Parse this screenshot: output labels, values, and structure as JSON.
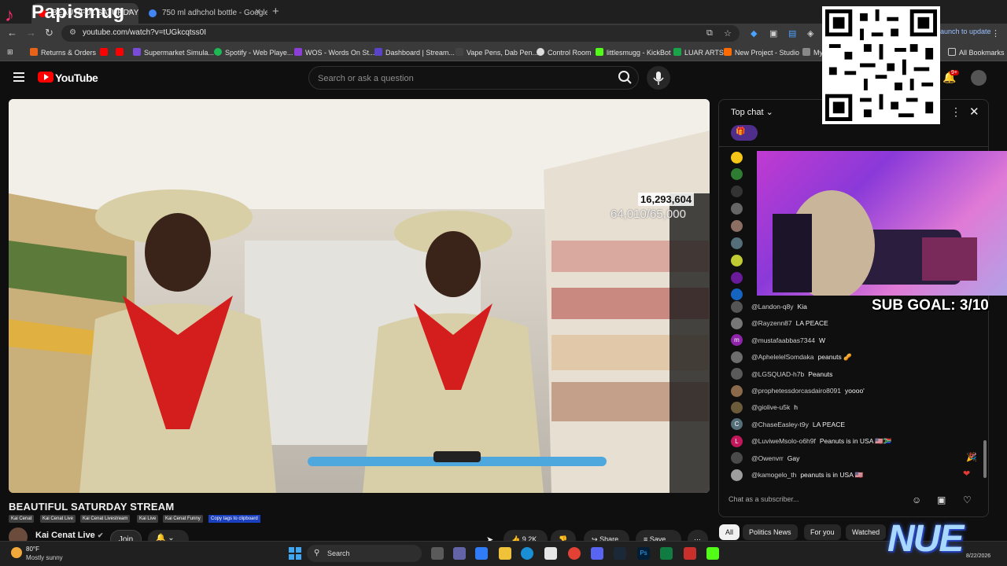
{
  "browser": {
    "branding": "Papismug",
    "tabs": [
      {
        "label": "BEAUTIFUL SATURDAY",
        "active": true
      },
      {
        "label": "750 ml adhchol bottle - Google",
        "active": false
      }
    ],
    "new_tab": "+",
    "url": "youtube.com/watch?v=tUGkcqtss0I",
    "launch_update": "Launch to update",
    "bookmarks": [
      {
        "label": "Returns & Orders",
        "color": "#e8631a"
      },
      {
        "label": "Supermarket Simula...",
        "color": "#7a4bd8"
      },
      {
        "label": "Spotify - Web Playe...",
        "color": "#1db954"
      },
      {
        "label": "WOS - Words On St...",
        "color": "#8b3fd6"
      },
      {
        "label": "Dashboard | Stream...",
        "color": "#5b43c8"
      },
      {
        "label": "Vape Pens, Dab Pen...",
        "color": "#444444"
      },
      {
        "label": "Control Room",
        "color": "#dddddd"
      },
      {
        "label": "littlesmugg - KickBot",
        "color": "#53fc18"
      },
      {
        "label": "LUAR ARTS",
        "color": "#1aa34a"
      },
      {
        "label": "New Project - Studio",
        "color": "#ff6b00"
      },
      {
        "label": "My",
        "color": "#888888"
      }
    ],
    "all_bookmarks": "All Bookmarks"
  },
  "youtube": {
    "wordmark": "YouTube",
    "search_placeholder": "Search or ask a question",
    "notifications": "9+"
  },
  "video": {
    "overlay_count": "16,293,604",
    "overlay_goal": "64,010/65,000",
    "title": "BEAUTIFUL SATURDAY STREAM",
    "tags": [
      "Kai Cenat",
      "Kai Cenat Live",
      "Kai Cenat Livestream",
      "Kai Live",
      "Kai Cenat Funny"
    ],
    "copy_tags": "Copy tags to clipboard",
    "channel": "Kai Cenat Live",
    "join": "Join",
    "likes": "9.2K",
    "share": "Share",
    "save": "Save"
  },
  "chat": {
    "header": "Top chat",
    "input_placeholder": "Chat as a subscriber...",
    "messages": [
      {
        "author": "@Landon-q8y",
        "text": "Kia",
        "color": "#555555"
      },
      {
        "author": "@Rayzenn87",
        "text": "LA PEACE",
        "color": "#777777"
      },
      {
        "author": "@mustafaabbas7344",
        "text": "W",
        "color": "#8e24aa",
        "initial": "m"
      },
      {
        "author": "@AphelelelSomdaka",
        "text": "peanuts 🥜",
        "color": "#6d6d6d"
      },
      {
        "author": "@LGSQUAD-h7b",
        "text": "Peanuts",
        "color": "#5a5a5a"
      },
      {
        "author": "@prophetessdorcasdairo8091",
        "text": "yoooo'",
        "color": "#8a6a4a"
      },
      {
        "author": "@giolive-u5k",
        "text": "h",
        "color": "#6b5b3a"
      },
      {
        "author": "@ChaseEasley-t9y",
        "text": "LA PEACE",
        "color": "#546e7a",
        "initial": "C"
      },
      {
        "author": "@LuviweMsolo-o6h9f",
        "text": "Peanuts is in USA 🇺🇸🇿🇦",
        "color": "#c2185b",
        "initial": "L"
      },
      {
        "author": "@Owenvrr",
        "text": "Gay",
        "color": "#4a4a4a"
      },
      {
        "author": "@kamogelo_th",
        "text": "peanuts is in USA 🇺🇸",
        "color": "#9e9e9e"
      }
    ]
  },
  "stream_overlay": {
    "sub_goal": "SUB GOAL: 3/10",
    "logo": "NUE"
  },
  "chips": [
    {
      "label": "All",
      "active": true
    },
    {
      "label": "Politics News",
      "active": false
    },
    {
      "label": "For you",
      "active": false
    },
    {
      "label": "Watched",
      "active": false
    }
  ],
  "taskbar": {
    "temperature": "80°F",
    "weather": "Mostly sunny",
    "search": "Search",
    "date": "8/22/2026"
  }
}
